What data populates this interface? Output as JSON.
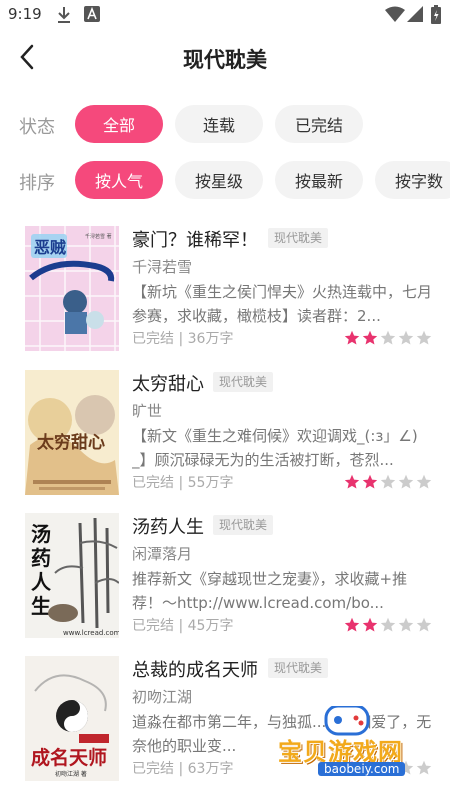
{
  "status_bar": {
    "time": "9:19",
    "icons": [
      "download-icon",
      "a-badge-icon",
      "wifi-icon",
      "signal-icon",
      "battery-icon"
    ]
  },
  "header": {
    "title": "现代耽美",
    "back_icon": "chevron-left-icon"
  },
  "filters": {
    "status": {
      "label": "状态",
      "options": [
        "全部",
        "连载",
        "已完结"
      ],
      "selected": "全部"
    },
    "sort": {
      "label": "排序",
      "options": [
        "按人气",
        "按星级",
        "按最新",
        "按字数"
      ],
      "selected": "按人气"
    }
  },
  "colors": {
    "accent": "#f5497c",
    "chip_bg": "#f3f3f3",
    "star_on": "#e8336e",
    "star_off": "#cccccc"
  },
  "books": [
    {
      "title": "豪门？谁稀罕！",
      "tag": "现代耽美",
      "author": "千浔若雪",
      "description": "【新坑《重生之侯门悍夫》火热连载中，七月参赛，求收藏，橄榄枝】读者群：2...",
      "status": "已完结",
      "words": "36万字",
      "rating": 2,
      "cover": {
        "text": "恶贼 ...",
        "publisher": "千浔若雪 著"
      }
    },
    {
      "title": "太穷甜心",
      "tag": "现代耽美",
      "author": "旷世",
      "description": "【新文《重生之难伺候》欢迎调戏_(:з」∠)_】顾沉碌碌无为的生活被打断，苍烈...",
      "status": "已完结",
      "words": "55万字",
      "rating": 2,
      "cover": {
        "text": "太穷甜心"
      }
    },
    {
      "title": "汤药人生",
      "tag": "现代耽美",
      "author": "闲潭落月",
      "description": "推荐新文《穿越现世之宠妻》，求收藏+推荐！～http://www.lcread.com/bo...",
      "status": "已完结",
      "words": "45万字",
      "rating": 2,
      "cover": {
        "text": "汤药人生",
        "url": "www.lcread.com"
      }
    },
    {
      "title": "总裁的成名天师",
      "tag": "现代耽美",
      "author": "初吻江湖",
      "description": "道淼在都市第二年，与独孤...相亲相爱了，无奈他的职业变...",
      "status": "已完结",
      "words": "63万字",
      "rating": 2,
      "cover": {
        "text": "总裁的成名天师",
        "subtext": "初吻江湖 著"
      }
    }
  ],
  "watermark": {
    "text": "宝贝游戏网",
    "url": "baobeiy.com"
  }
}
